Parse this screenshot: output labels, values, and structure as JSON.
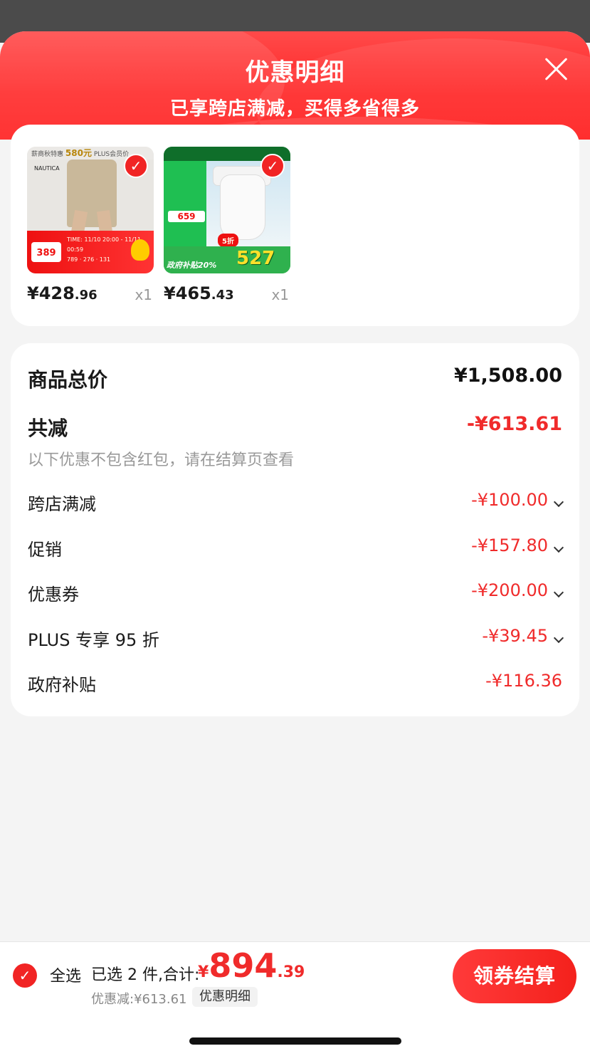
{
  "header": {
    "title": "优惠明细",
    "subtitle": "已享跨店满减，买得多省得多"
  },
  "products": [
    {
      "price_int": "¥428",
      "price_dec": ".96",
      "qty": "x1",
      "thumb": {
        "banner_prefix": "薪商秋特惠",
        "banner_amount": "580元",
        "banner_suffix": "PLUS会员价",
        "brand": "NAUTICA",
        "price": "389",
        "line1": "TIME: 11/10 20:00 - 11/11 00:59",
        "line2": "789 · 276 · 131"
      }
    },
    {
      "price_int": "¥465",
      "price_dec": ".43",
      "qty": "x1",
      "thumb": {
        "price": "659",
        "big": "527",
        "gov": "政府补贴20%",
        "disc": "5折"
      }
    }
  ],
  "summary": {
    "total_label": "商品总价",
    "total_value": "¥1,508.00",
    "reduce_label": "共减",
    "reduce_value": "-¥613.61",
    "note": "以下优惠不包含红包，请在结算页查看",
    "lines": [
      {
        "label": "跨店满减",
        "value": "-¥100.00"
      },
      {
        "label": "促销",
        "value": "-¥157.80"
      },
      {
        "label": "优惠券",
        "value": "-¥200.00"
      },
      {
        "label": "PLUS 专享 95 折",
        "value": "-¥39.45"
      },
      {
        "label": "政府补贴",
        "value": "-¥116.36"
      }
    ]
  },
  "bottom": {
    "select_all": "全选",
    "picked": "已选 2 件,合计:",
    "currency": "¥",
    "total_int": "894",
    "total_dec": ".39",
    "saved": "优惠减:¥613.61",
    "detail": "优惠明细",
    "checkout": "领券结算"
  },
  "colors": {
    "accent": "#f02b2b",
    "header": "#ff2727"
  }
}
